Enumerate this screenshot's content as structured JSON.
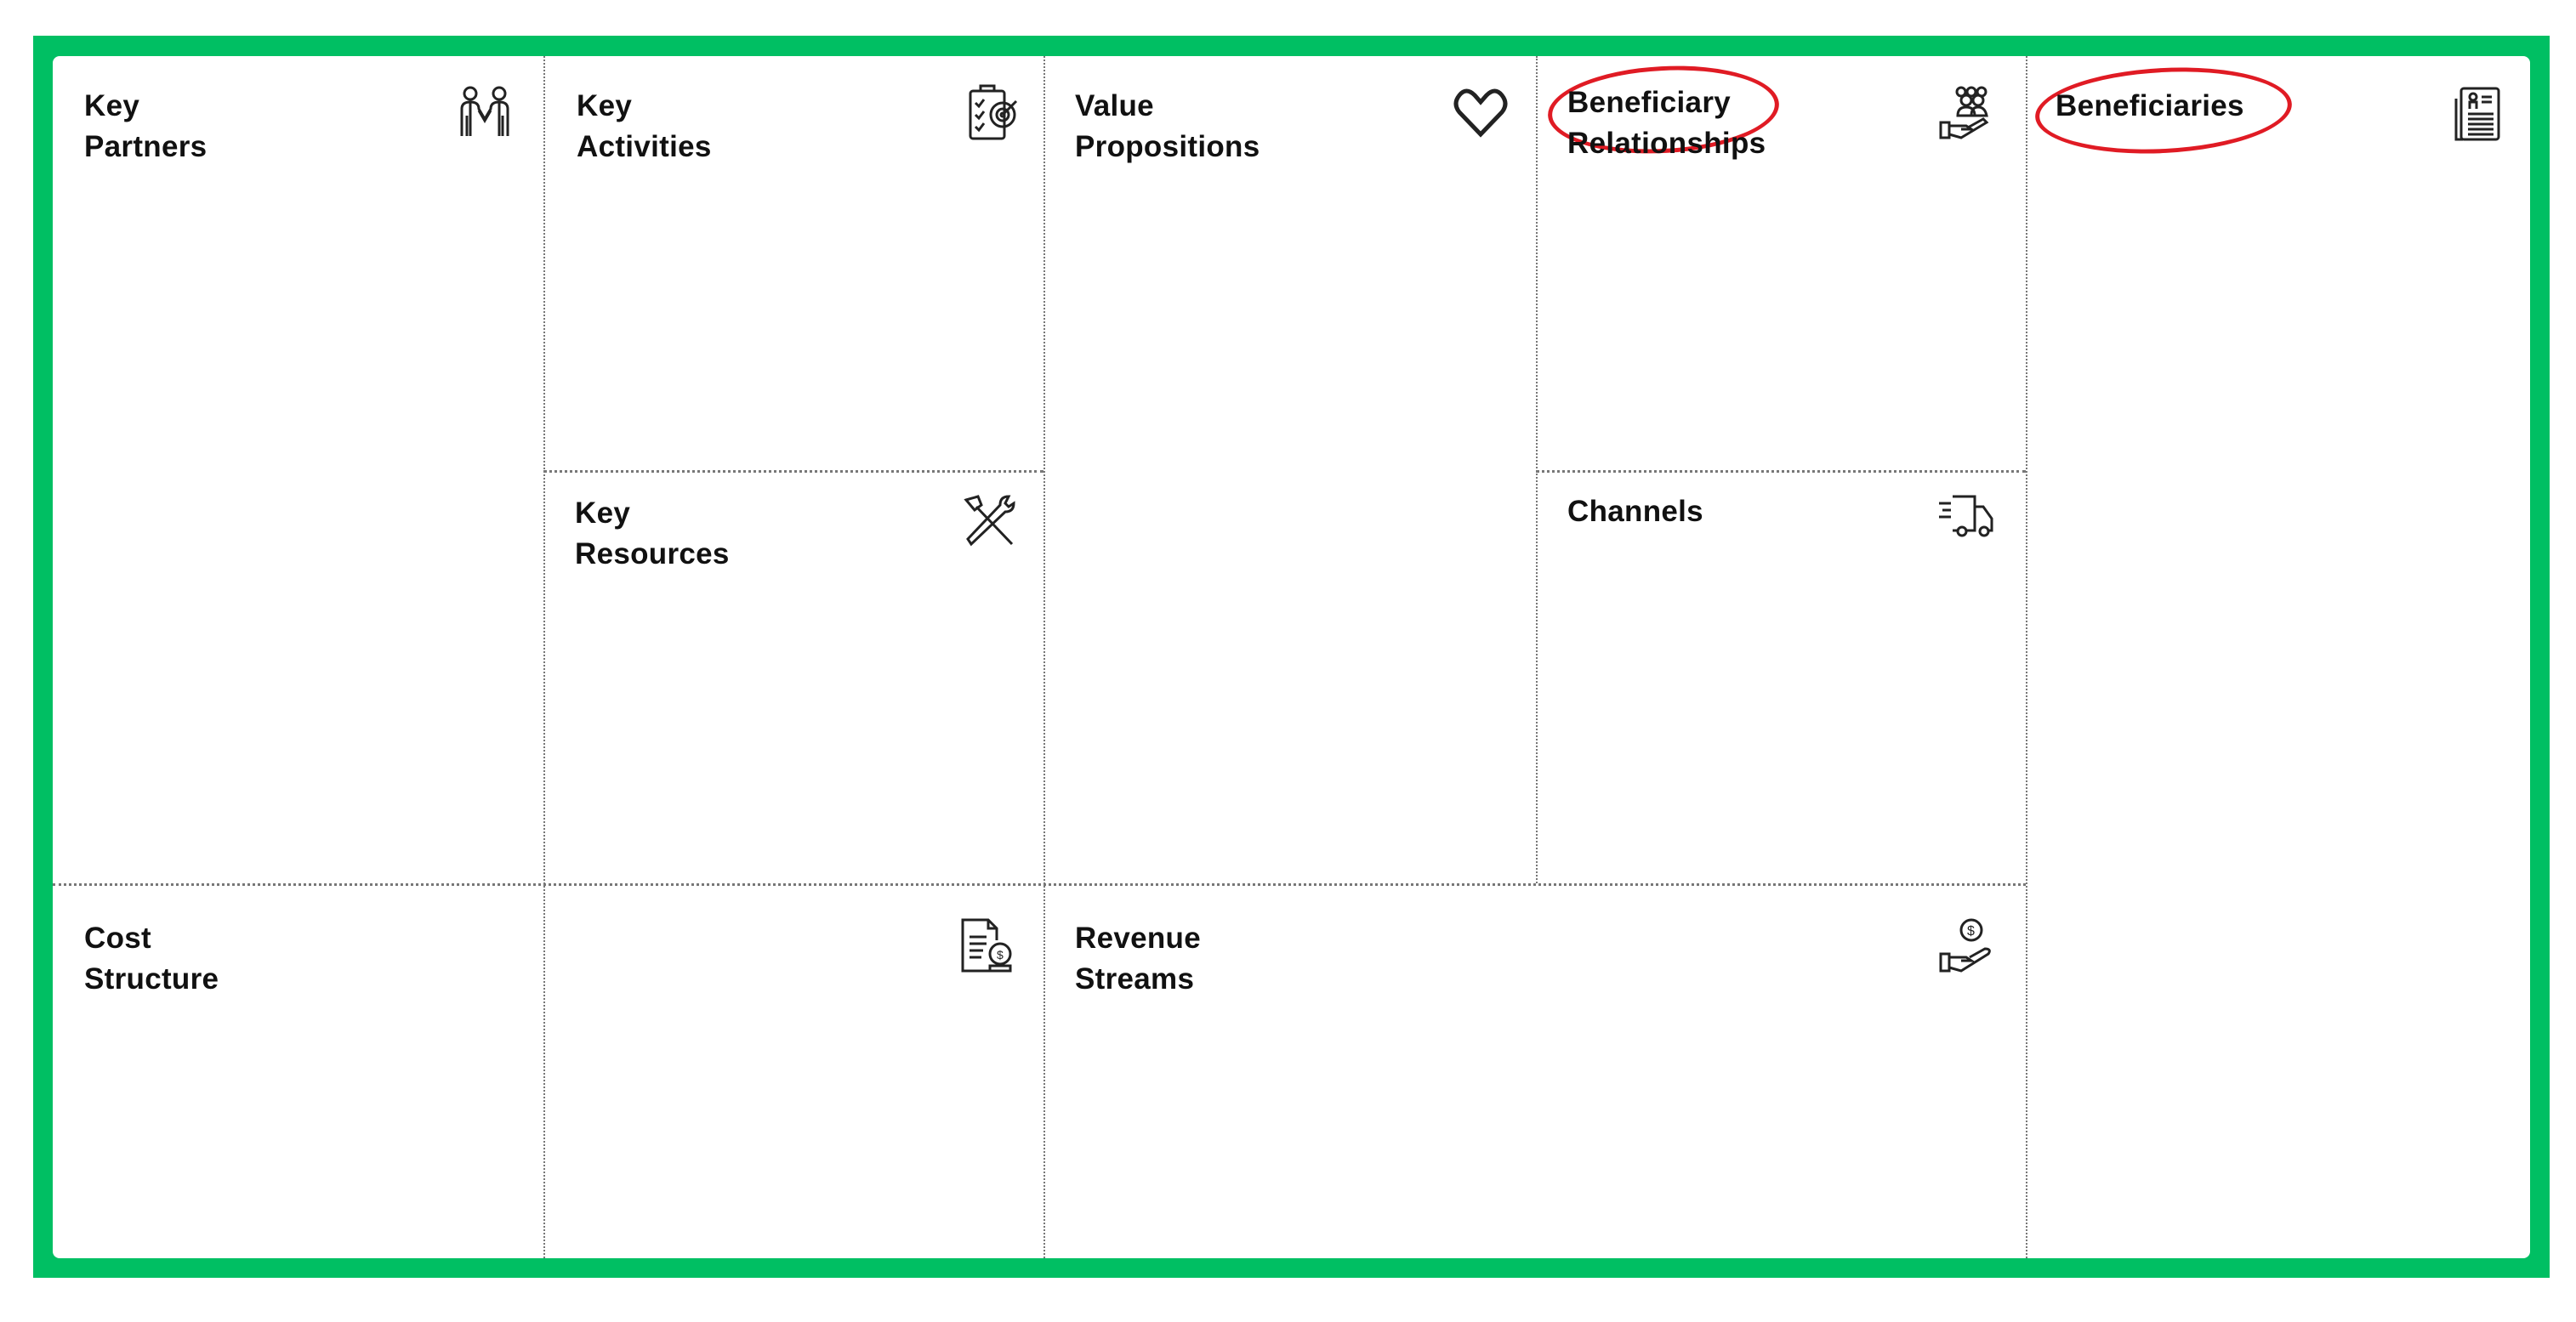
{
  "canvas": {
    "frame_color": "#00bf63",
    "highlight_color": "#e01b24",
    "blocks": {
      "key_partners": {
        "title": "Key Partners",
        "icon": "handshake-partners-icon"
      },
      "key_activities": {
        "title": "Key Activities",
        "icon": "clipboard-target-icon"
      },
      "key_resources": {
        "title": "Key Resources",
        "icon": "hammer-wrench-icon"
      },
      "value_propositions": {
        "title": "Value Propositions",
        "icon": "heart-icon"
      },
      "beneficiary_relationships": {
        "title_line1": "Beneficiary",
        "title_line2": "Relationships",
        "icon": "people-hand-icon",
        "highlighted": true
      },
      "channels": {
        "title": "Channels",
        "icon": "delivery-truck-icon"
      },
      "beneficiaries": {
        "title": "Beneficiaries",
        "icon": "profile-document-icon",
        "highlighted": true
      },
      "cost_structure": {
        "title": "Cost Structure",
        "icon": "invoice-coin-icon"
      },
      "revenue_streams": {
        "title": "Revenue Streams",
        "icon": "hand-coin-icon"
      }
    }
  }
}
